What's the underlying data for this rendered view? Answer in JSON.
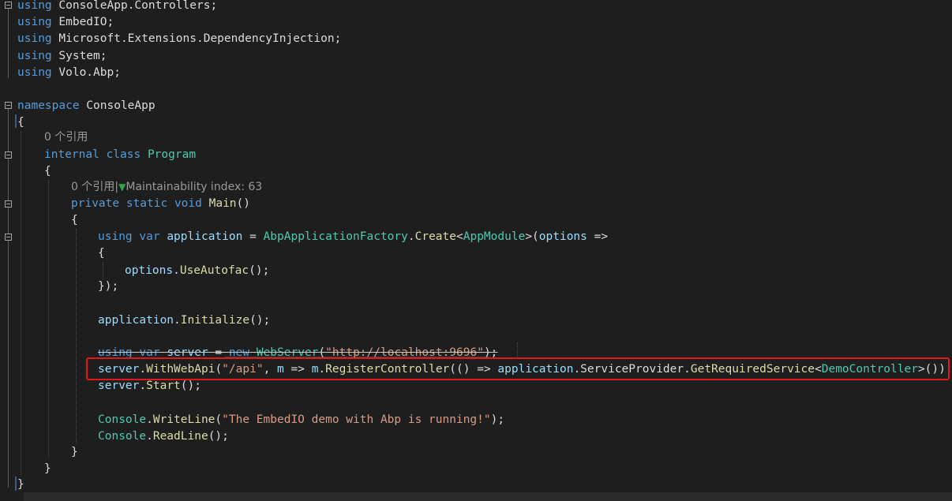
{
  "editor": {
    "lines": {
      "l1": {
        "kw": "using",
        "rest": " ConsoleApp.Controllers;"
      },
      "l2": {
        "kw": "using",
        "rest": " EmbedIO;"
      },
      "l3": {
        "kw": "using",
        "rest": " Microsoft.Extensions.DependencyInjection;"
      },
      "l4": {
        "kw": "using",
        "rest": " System;"
      },
      "l5": {
        "kw": "using",
        "rest": " Volo.Abp;"
      },
      "l7": {
        "kw": "namespace",
        "rest": " ConsoleApp"
      },
      "l8": {
        "text": "{"
      },
      "lens1": "0 个引用",
      "l10": {
        "kw": "internal class",
        "cls": "Program"
      },
      "l11": {
        "text": "{"
      },
      "lens2": {
        "refs": "0 个引用",
        "sep": "|",
        "icon": "▼",
        "maint": "Maintainability index: 63"
      },
      "l13": {
        "kw": "private static void",
        "mth": "Main",
        "rest": "()"
      },
      "l14": {
        "text": "{"
      },
      "l15": {
        "kw1": "using var",
        "v": "application",
        "op": " = ",
        "cls": "AbpApplicationFactory",
        "dot": ".",
        "mth": "Create",
        "lt": "<",
        "cls2": "AppModule",
        "gt": ">(",
        "v2": "options",
        "arrow": " =>"
      },
      "l16": {
        "text": "{"
      },
      "l17": {
        "v": "options",
        "dot": ".",
        "mth": "UseAutofac",
        "rest": "();"
      },
      "l18": {
        "text": "});"
      },
      "l20": {
        "v": "application",
        "dot": ".",
        "mth": "Initialize",
        "rest": "();"
      },
      "l22": {
        "kw1": "using var",
        "v": "server",
        "op": " = ",
        "kw2": "new",
        "cls": "WebServer",
        "p1": "(",
        "s": "\"http://localhost:9696\"",
        "p2": ");"
      },
      "l23": {
        "v": "server",
        "dot": ".",
        "mth": "WithWebApi",
        "p1": "(",
        "s": "\"/api\"",
        "c": ", ",
        "v2": "m",
        "arrow": " => ",
        "v3": "m",
        "dot2": ".",
        "mth2": "RegisterController",
        "p2": "(() => ",
        "v4": "application",
        "dot3": ".",
        "prop": "ServiceProvider",
        "dot4": ".",
        "mth3": "GetRequiredService",
        "lt": "<",
        "cls": "DemoController",
        "gt": ">());"
      },
      "l24": {
        "v": "server",
        "dot": ".",
        "mth": "Start",
        "rest": "();"
      },
      "l26": {
        "cls": "Console",
        "dot": ".",
        "mth": "WriteLine",
        "p1": "(",
        "s": "\"The EmbedIO demo with Abp is running!\"",
        "p2": ");"
      },
      "l27": {
        "cls": "Console",
        "dot": ".",
        "mth": "ReadLine",
        "rest": "();"
      },
      "l28": {
        "text": "}"
      },
      "l29": {
        "text": "}"
      },
      "l30": {
        "text": "}"
      }
    }
  }
}
